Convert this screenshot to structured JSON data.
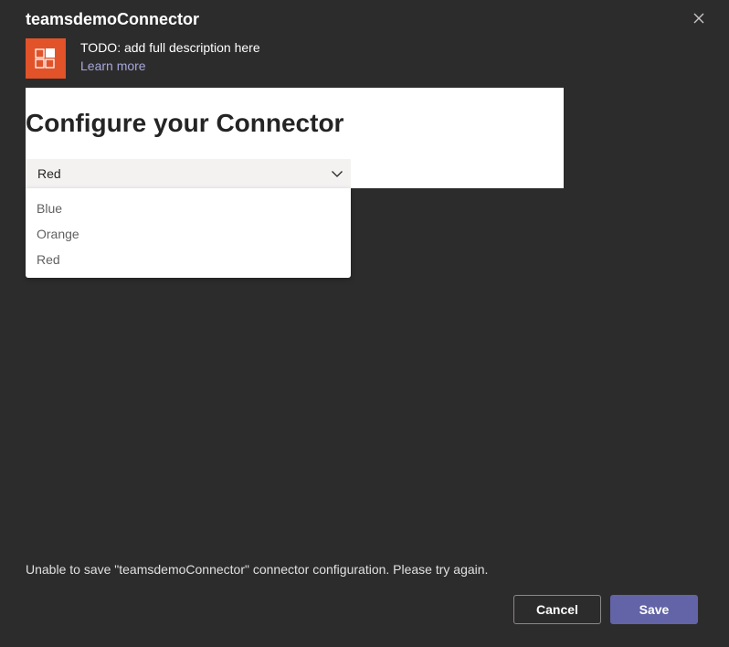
{
  "dialog": {
    "title": "teamsdemoConnector",
    "close_icon": "close-icon"
  },
  "app": {
    "logo_icon": "app-grid-icon",
    "logo_color": "#e2532a",
    "description": "TODO: add full description here",
    "learn_more": "Learn more"
  },
  "config": {
    "heading": "Configure your Connector",
    "select": {
      "value": "Red",
      "options": [
        "Blue",
        "Orange",
        "Red"
      ]
    }
  },
  "footer": {
    "error": "Unable to save \"teamsdemoConnector\" connector configuration. Please try again.",
    "cancel_label": "Cancel",
    "save_label": "Save"
  },
  "colors": {
    "background": "#2d2c2c",
    "accent": "#6264a7",
    "link": "#a6a7dc"
  }
}
